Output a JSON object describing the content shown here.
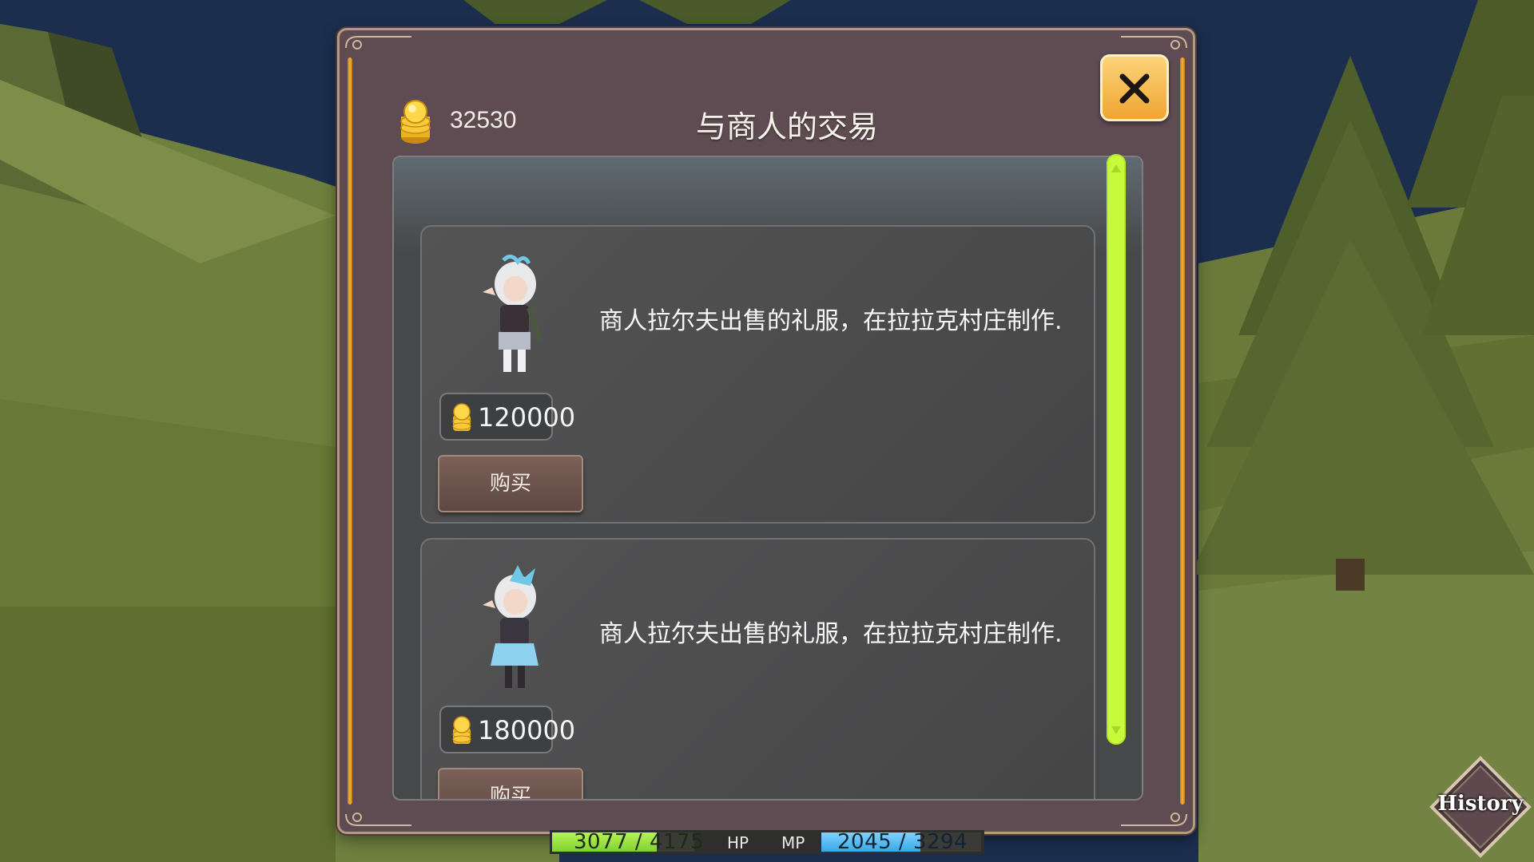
{
  "currency": {
    "amount": "32530",
    "icon": "gold-coin-stack-icon"
  },
  "dialog": {
    "title": "与商人的交易",
    "close_icon": "close-x-icon"
  },
  "shop": {
    "items": [
      {
        "description": "商人拉尔夫出售的礼服，在拉拉克村庄制作.",
        "price": "120000",
        "buy_label": "购买",
        "outfit": "dark-dress"
      },
      {
        "description": "商人拉尔夫出售的礼服，在拉拉克村庄制作.",
        "price": "180000",
        "buy_label": "购买",
        "outfit": "blue-dress"
      }
    ],
    "scrollbar_color": "#c8fa3c"
  },
  "status": {
    "hp_value": "3077 / 4175",
    "hp_label": "HP",
    "hp_fraction": 0.737,
    "mp_value": "2045 / 3294",
    "mp_label": "MP",
    "mp_fraction": 0.621
  },
  "history_button": {
    "label": "History"
  },
  "colors": {
    "dialog_bg": "#5e4c52",
    "gold_rail": "#f5b338",
    "close_button": "#f0a531",
    "hp_bar": "#9be243",
    "mp_bar": "#4fb8ef"
  }
}
